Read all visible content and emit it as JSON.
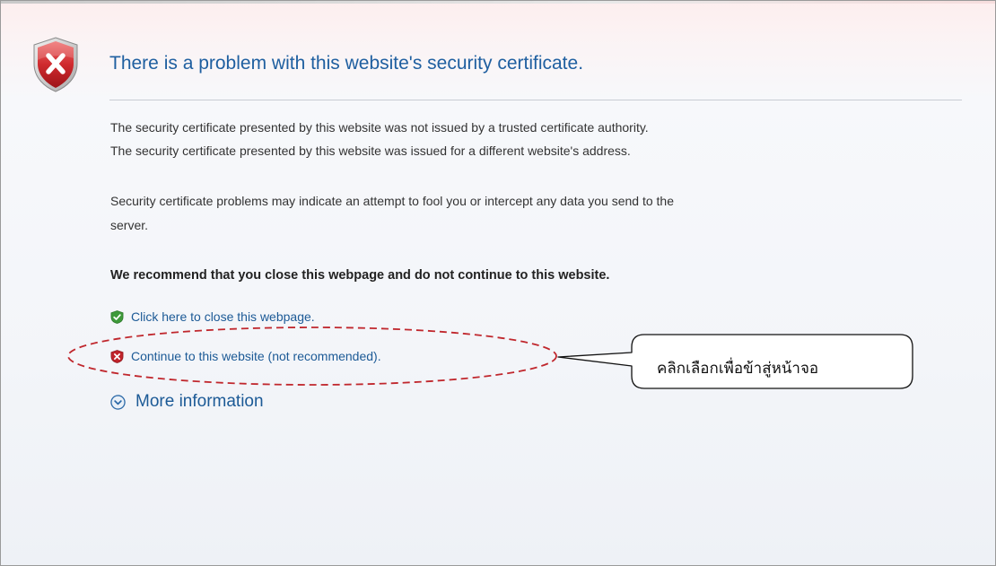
{
  "page": {
    "title": "There is a problem with this website's security certificate.",
    "details": [
      "The security certificate presented by this website was not issued by a trusted certificate authority.",
      "The security certificate presented by this website was issued for a different website's address."
    ],
    "warning": [
      "Security certificate problems may indicate an attempt to fool you or intercept any data you send to the",
      "server."
    ],
    "recommendation": "We recommend that you close this webpage and do not continue to this website.",
    "links": {
      "close": "Click here to close this webpage.",
      "continue": "Continue to this website (not recommended).",
      "more_info": "More information"
    }
  },
  "annotation": {
    "callout_text": "คลิกเลือกเพื่อข้าสู่หน้าจอ"
  },
  "icons": {
    "header": "shield-error-icon",
    "close": "shield-check-icon",
    "continue": "shield-error-icon",
    "more_info": "circle-chevron-down-icon"
  },
  "colors": {
    "link": "#1c5a96",
    "title": "#1f5fa0",
    "error_red": "#c0242b",
    "ok_green": "#3e9a3a",
    "annotation_red": "#c0272d"
  }
}
